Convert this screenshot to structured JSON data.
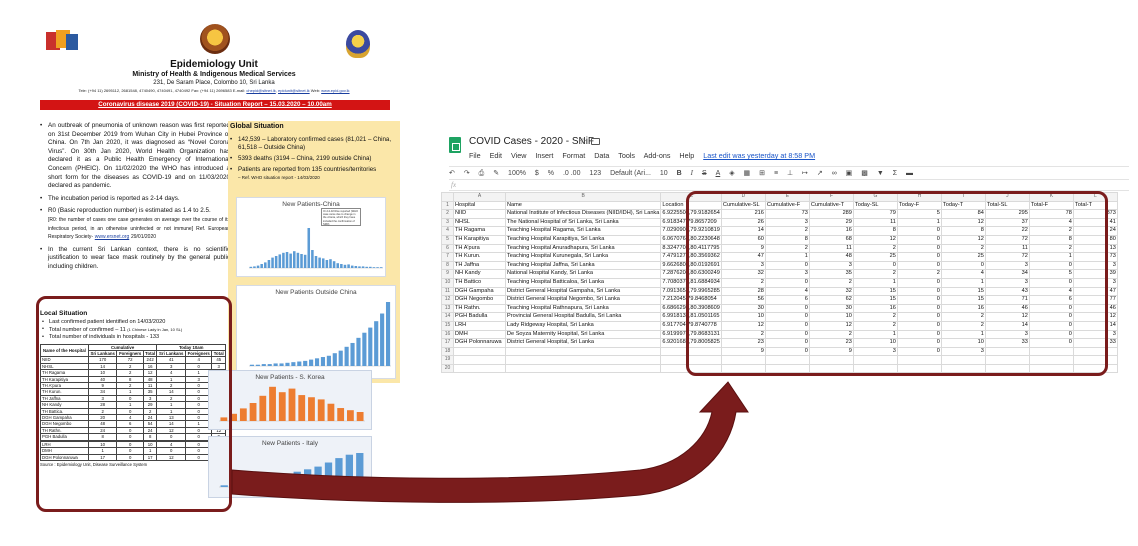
{
  "report": {
    "unit_title": "Epidemiology Unit",
    "ministry": "Ministry of Health & Indigenous Medical Services",
    "address": "231, De Saram Place, Colombo 10, Sri Lanka",
    "contact_prefix": "Tele: (+94 11) 2695112, 2681548, 4740490, 4740491, 4740492 Fax: (+94 11) 2696583 E-mail:",
    "contact_email": "chepid@sltnet.lk",
    "contact_email2": "epidunit@sltnet.lk",
    "contact_web_label": "Web:",
    "contact_web": "www.epid.gov.lk",
    "banner": "Coronavirus disease 2019 (COVID-19) - Situation Report – 15.03.2020 – 10.00am",
    "intro_items": [
      "An outbreak of pneumonia of unknown reason was first reported on 31st December 2019 from Wuhan City in Hubei Province of China. On 7th Jan 2020, it was diagnosed as “Novel Corona Virus”. On 30th Jan 2020, World Health Organization has declared it as a Public Health Emergency of International Concern (PHEIC). On 11/02/2020 the WHO has introduced a short form for the diseases as COVID-19 and on 11/03/2020 declared as pandemic.",
      "The incubation period is reported as 2-14 days.",
      "R0 (Basic reproduction number) is estimated as 1.4 to 2.5.",
      "In the current Sri Lankan context, there is no scientific justification to wear face mask routinely by the general public including children."
    ],
    "r0_note": "[R0: the number of cases one case generates on average over the course of its infectious period, in an otherwise uninfected or not immune] Ref. European Respiratory Society-",
    "r0_link": "www.ersnet.org",
    "r0_date": "29/01/2020",
    "global": {
      "title": "Global Situation",
      "items": [
        "142,539 – Laboratory confirmed cases (81,021 – China, 61,518 – Outside China)",
        "5393 deaths (3194 – China, 2199 outside China)",
        "Patients are reported from 135 countries/territories"
      ],
      "ref": "– Ref. WHO situation report - 14/03/2020"
    },
    "charts": {
      "china_title": "New Patients-China",
      "china_note": "On 12-02 Rise reported (WHO case came due to change in the criteria, which they have included the confirmation of SRD)",
      "outside_title": "New Patients Outside China",
      "korea_title": "New Patients - S. Korea",
      "italy_title": "New Patients - Italy"
    },
    "local": {
      "title": "Local Situation",
      "items": [
        "Last confirmed patient identified on 14/03/2020",
        "Total number of confirmed – 11",
        "Total number of individuals in hospitals - 133"
      ],
      "confirmed_note": "(1 Chinese Lady in Jan, 10 SL)",
      "table_head": {
        "name": "Name of the Hospital",
        "cumulative": "Cumulative",
        "today": "Today 10am",
        "sri_lankans": "Sri Lankans",
        "foreigners": "Foreigners",
        "total": "Total"
      },
      "rows": [
        [
          "NIID",
          "170",
          "72",
          "242",
          "41",
          "4",
          "45"
        ],
        [
          "NHSL",
          "14",
          "2",
          "16",
          "3",
          "0",
          "3"
        ],
        [
          "TH Ragama",
          "10",
          "2",
          "12",
          "4",
          "1",
          "5"
        ],
        [
          "TH Karapitiya",
          "40",
          "8",
          "48",
          "1",
          "3",
          "4"
        ],
        [
          "TH A'pura",
          "9",
          "2",
          "11",
          "2",
          "0",
          "2"
        ],
        [
          "TH Kurun.",
          "34",
          "1",
          "35",
          "14",
          "0",
          "14"
        ],
        [
          "TH Jaffna",
          "3",
          "0",
          "3",
          "2",
          "0",
          "2"
        ],
        [
          "NH Kandy",
          "28",
          "1",
          "29",
          "1",
          "0",
          "1"
        ],
        [
          "TH Battica.",
          "2",
          "0",
          "2",
          "1",
          "0",
          "1"
        ],
        [
          "DGH Gampaha",
          "20",
          "4",
          "24",
          "13",
          "0",
          "13"
        ],
        [
          "DGH Negombo",
          "48",
          "6",
          "54",
          "14",
          "1",
          "15"
        ],
        [
          "TH Rathn.",
          "24",
          "0",
          "24",
          "12",
          "0",
          "12"
        ],
        [
          "PGH Badulla",
          "8",
          "0",
          "8",
          "0",
          "0",
          "0"
        ],
        [
          "",
          "",
          "",
          "",
          "",
          "",
          ""
        ],
        [
          "LRH",
          "10",
          "0",
          "10",
          "4",
          "0",
          "4"
        ],
        [
          "DMH",
          "1",
          "0",
          "1",
          "0",
          "0",
          "0"
        ],
        [
          "DGH Polonnaruwa",
          "17",
          "0",
          "17",
          "12",
          "0",
          "12"
        ]
      ],
      "source": "Source : Epidemiology Unit, Disease Surveillance System"
    }
  },
  "sheet": {
    "title": "COVID Cases - 2020 - SNiF",
    "star_icon": "☆",
    "menu": [
      "File",
      "Edit",
      "View",
      "Insert",
      "Format",
      "Data",
      "Tools",
      "Add-ons",
      "Help"
    ],
    "last_edit": "Last edit was yesterday at 8:58 PM",
    "toolbar": {
      "zoom": "100%",
      "currency": "$",
      "percent": "%",
      "decimals": ".0  .00",
      "format": "123",
      "font": "Default (Ari...",
      "size": "10",
      "bold": "B",
      "italic": "I",
      "strike": "S",
      "text_color": "A"
    },
    "fx_label": "fx",
    "columns": [
      "A",
      "B",
      "C",
      "D",
      "E",
      "F",
      "G",
      "H",
      "I",
      "J",
      "K",
      "L"
    ],
    "header_row": [
      "Hospital",
      "Name",
      "Location",
      "Cumulative-SL",
      "Cumulative-F",
      "Cumulative-T",
      "Today-SL",
      "Today-F",
      "Today-T",
      "Total-SL",
      "Total-F",
      "Total-T"
    ],
    "rows": [
      [
        "NIID",
        "National Institute of Infectious Diseases (NIID/IDH), Sri Lanka",
        "6.9225508,79.9182654",
        "216",
        "73",
        "289",
        "79",
        "5",
        "84",
        "295",
        "78",
        "373"
      ],
      [
        "NHSL",
        "The National Hospital of Sri Lanka, Sri Lanka",
        "6.918347,79.8657209",
        "26",
        "3",
        "29",
        "11",
        "1",
        "12",
        "37",
        "4",
        "41"
      ],
      [
        "TH Ragama",
        "Teaching Hospital Ragama, Sri Lanka",
        "7.0290907,79.9210819",
        "14",
        "2",
        "16",
        "8",
        "0",
        "8",
        "22",
        "2",
        "24"
      ],
      [
        "TH Karapitiya",
        "Teaching Hospital Karapitiya, Sri Lanka",
        "6.0670761,80.2230648",
        "60",
        "8",
        "68",
        "12",
        "0",
        "12",
        "72",
        "8",
        "80"
      ],
      [
        "TH A'pura",
        "Teaching Hospital Anuradhapura, Sri Lanka",
        "8.3247705,80.4117795",
        "9",
        "2",
        "11",
        "2",
        "0",
        "2",
        "11",
        "2",
        "13"
      ],
      [
        "TH Kurun.",
        "Teaching Hospital Kurunegala, Sri Lanka",
        "7.4791271,80.3569362",
        "47",
        "1",
        "48",
        "25",
        "0",
        "25",
        "72",
        "1",
        "73"
      ],
      [
        "TH Jaffna",
        "Teaching Hospital Jaffna, Sri Lanka",
        "9.6626803,80.0192691",
        "3",
        "0",
        "3",
        "0",
        "0",
        "0",
        "3",
        "0",
        "3"
      ],
      [
        "NH Kandy",
        "National Hospital Kandy, Sri Lanka",
        "7.2876208,80.6300249",
        "32",
        "3",
        "35",
        "2",
        "2",
        "4",
        "34",
        "5",
        "39"
      ],
      [
        "TH Battico",
        "Teaching Hospital Batticaloa, Sri Lanka",
        "7.7080376,81.6884934",
        "2",
        "0",
        "2",
        "1",
        "0",
        "1",
        "3",
        "0",
        "3"
      ],
      [
        "DGH Gampaha",
        "District General Hospital Gampaha, Sri Lanka",
        "7.0913651,79.9965285",
        "28",
        "4",
        "32",
        "15",
        "0",
        "15",
        "43",
        "4",
        "47"
      ],
      [
        "DGH Negombo",
        "District General Hospital Negombo, Sri Lanka",
        "7.212045,79.8468054",
        "56",
        "6",
        "62",
        "15",
        "0",
        "15",
        "71",
        "6",
        "77"
      ],
      [
        "TH Rathn.",
        "Teaching Hospital Rathnapura, Sri Lanka",
        "6.6866298,80.3908609",
        "30",
        "0",
        "30",
        "16",
        "0",
        "16",
        "46",
        "0",
        "46"
      ],
      [
        "PGH Badulla",
        "Provincial General Hospital Badulla, Sri Lanka",
        "6.9918137,81.0501165",
        "10",
        "0",
        "10",
        "2",
        "0",
        "2",
        "12",
        "0",
        "12"
      ],
      [
        "LRH",
        "Lady Ridgeway Hospital, Sri Lanka",
        "6.917704,79.8740778",
        "12",
        "0",
        "12",
        "2",
        "0",
        "2",
        "14",
        "0",
        "14"
      ],
      [
        "DMH",
        "De Soyza Maternity Hospital, Sri Lanka",
        "6.9199976,79.8683131",
        "2",
        "0",
        "2",
        "1",
        "0",
        "1",
        "3",
        "0",
        "3"
      ],
      [
        "DGH Polonnaruwa",
        "District General Hospital, Sri Lanka",
        "6.9201682,79.8005825",
        "23",
        "0",
        "23",
        "10",
        "0",
        "10",
        "33",
        "0",
        "33"
      ],
      [
        "",
        "",
        "",
        "9",
        "0",
        "9",
        "3",
        "0",
        "3",
        "",
        "",
        ""
      ],
      [
        "",
        "",
        "",
        "",
        "",
        "",
        "",
        "",
        "",
        "",
        "",
        ""
      ],
      [
        "",
        "",
        "",
        "",
        "",
        "",
        "",
        "",
        "",
        "",
        "",
        ""
      ]
    ]
  },
  "colors": {
    "highlight": "#7a1c1c",
    "banner": "#d31414",
    "global_bg": "#fbe7a9",
    "sheets_green": "#1ea362",
    "bar_blue": "#5b9bd5",
    "bar_orange": "#ed7d31"
  }
}
